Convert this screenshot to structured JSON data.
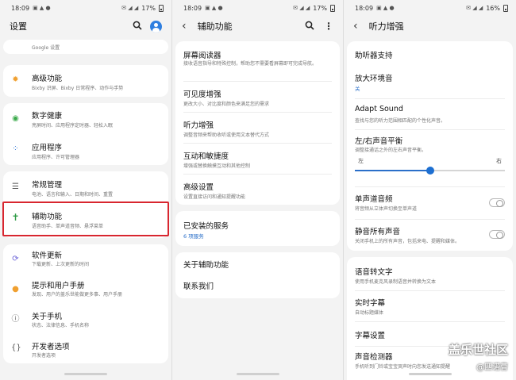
{
  "status": {
    "p1": {
      "time": "18:09",
      "battery": "17%"
    },
    "p2": {
      "time": "18:09",
      "battery": "17%"
    },
    "p3": {
      "time": "18:09",
      "battery": "16%"
    }
  },
  "settings": {
    "title": "设置",
    "google_sub": "Google 设置",
    "items": [
      {
        "title": "高级功能",
        "sub": "Bixby 识屏、Bixby 日常程序、动作与手势",
        "icon": "star-gear-icon"
      },
      {
        "title": "数字健康",
        "sub": "亮屏时间、应用程序定时器、轻松入眠",
        "icon": "wellbeing-icon"
      },
      {
        "title": "应用程序",
        "sub": "应用程序、许可管理器",
        "icon": "apps-icon"
      },
      {
        "title": "常规管理",
        "sub": "电池、语言和输入、日期和时间、重置",
        "icon": "sliders-icon"
      },
      {
        "title": "辅助功能",
        "sub": "语音助手、单声道音频、悬浮菜单",
        "icon": "accessibility-icon"
      },
      {
        "title": "软件更新",
        "sub": "下载更新、上次更新的时间",
        "icon": "update-icon"
      },
      {
        "title": "提示和用户手册",
        "sub": "发现、用户的盖乐世能做更多事、用户手册",
        "icon": "lightbulb-icon"
      },
      {
        "title": "关于手机",
        "sub": "状态、法律信息、手机名称",
        "icon": "info-icon"
      },
      {
        "title": "开发者选项",
        "sub": "开发者选项",
        "icon": "braces-icon"
      }
    ]
  },
  "accessibility": {
    "title": "辅助功能",
    "screen_reader": {
      "title": "屏幕阅读器",
      "sub": "接收语音指导和特殊控制，帮助您不需要看屏幕即可完成导航。"
    },
    "visibility": {
      "title": "可见度增强",
      "sub": "更改大小、对比度和颜色来满足您的需求"
    },
    "hearing": {
      "title": "听力增强",
      "sub": "调整音频来帮助收听或使用文本替代方式"
    },
    "interaction": {
      "title": "互动和敏捷度",
      "sub": "增强或替换触摸互动和其他控制"
    },
    "advanced": {
      "title": "高级设置",
      "sub": "设置直接访问和通知提醒功能"
    },
    "installed": {
      "title": "已安装的服务",
      "sub": "6 项服务"
    },
    "about": {
      "title": "关于辅助功能"
    },
    "contact": {
      "title": "联系我们"
    }
  },
  "hearing": {
    "title": "听力增强",
    "hearing_aid": {
      "title": "助听器支持"
    },
    "amplify": {
      "title": "放大环境音",
      "value": "关"
    },
    "adapt_sound": {
      "title": "Adapt Sound",
      "sub": "查找与您的听力范围相匹配的个性化声音。"
    },
    "balance": {
      "title": "左/右声音平衡",
      "sub": "调整接通话之外的左右声音平衡。",
      "left": "左",
      "right": "右",
      "level": 0.5
    },
    "mono": {
      "title": "单声道音频",
      "sub": "将音频从立体声切换至单声道"
    },
    "mute_all": {
      "title": "静音所有声音",
      "sub": "关闭手机上的所有声音，包括来电、提醒和媒体。"
    },
    "speech_to_text": {
      "title": "语音转文字",
      "sub": "使用手机麦克风录制语音并转换为文本"
    },
    "live_caption": {
      "title": "实时字幕",
      "sub": "自动标题媒体"
    },
    "caption_settings": {
      "title": "字幕设置"
    },
    "sound_detector": {
      "title": "声音检测器",
      "sub": "手机听到门铃或宝宝哭声时向您发送通知提醒"
    }
  },
  "watermark": {
    "brand": "盖乐世社区",
    "user": "@匹诺曹"
  },
  "colors": {
    "accent": "#2a6fc9",
    "highlight": "#d8262f"
  }
}
